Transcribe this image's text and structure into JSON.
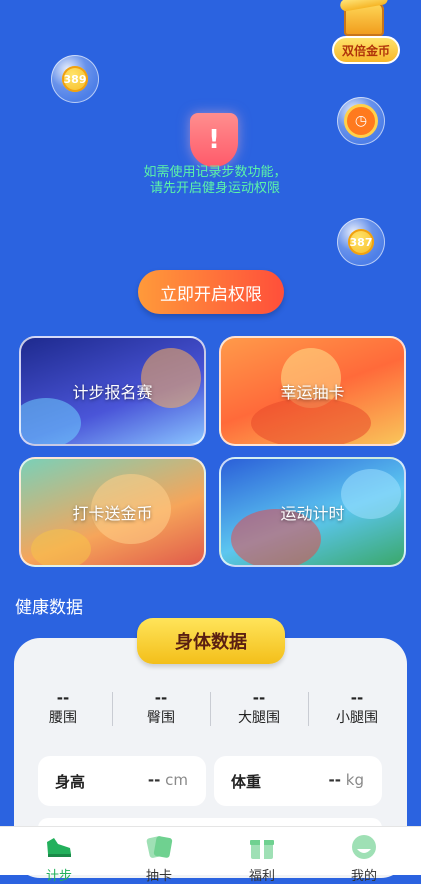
{
  "top": {
    "double_coin_label": "双倍金币",
    "bubble_left_coin": "389",
    "bubble_right_coin": "387"
  },
  "permission": {
    "warning_line1": "如需使用记录步数功能，",
    "warning_line2": "请先开启健身运动权限",
    "open_button": "立即开启权限"
  },
  "cards": [
    {
      "label": "计步报名赛"
    },
    {
      "label": "幸运抽卡"
    },
    {
      "label": "打卡送金币"
    },
    {
      "label": "运动计时"
    }
  ],
  "health": {
    "section_title": "健康数据",
    "tab_label": "身体数据",
    "measures": [
      {
        "value": "--",
        "label": "腰围"
      },
      {
        "value": "--",
        "label": "臀围"
      },
      {
        "value": "--",
        "label": "大腿围"
      },
      {
        "value": "--",
        "label": "小腿围"
      }
    ],
    "height": {
      "label": "身高",
      "value": "--",
      "unit": "cm"
    },
    "weight": {
      "label": "体重",
      "value": "--",
      "unit": "kg"
    }
  },
  "nav": {
    "items": [
      {
        "label": "计步",
        "icon": "shoe-icon"
      },
      {
        "label": "抽卡",
        "icon": "cards-icon"
      },
      {
        "label": "福利",
        "icon": "gift-icon"
      },
      {
        "label": "我的",
        "icon": "profile-icon"
      }
    ],
    "active_color": "#23b05c"
  },
  "colors": {
    "background": "#2b63e0",
    "button_gradient_start": "#ff9a3a",
    "button_gradient_end": "#ff4f3a",
    "warning_text": "#5cf4a8"
  }
}
